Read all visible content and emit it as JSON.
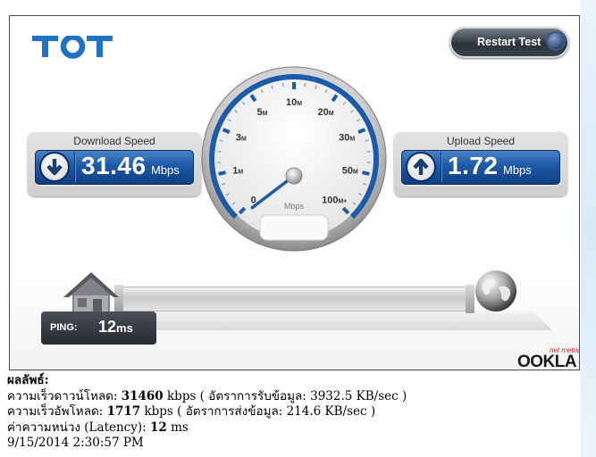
{
  "logo": {
    "text": "TOT"
  },
  "restart_button": {
    "label": "Restart Test"
  },
  "download": {
    "title": "Download Speed",
    "value": "31.46",
    "unit": "Mbps"
  },
  "upload": {
    "title": "Upload Speed",
    "value": "1.72",
    "unit": "Mbps"
  },
  "gauge": {
    "unit": "Mbps",
    "labels": [
      {
        "n": "0",
        "s": ""
      },
      {
        "n": "1",
        "s": "M"
      },
      {
        "n": "3",
        "s": "M"
      },
      {
        "n": "5",
        "s": "M"
      },
      {
        "n": "10",
        "s": "M"
      },
      {
        "n": "20",
        "s": "M"
      },
      {
        "n": "30",
        "s": "M"
      },
      {
        "n": "50",
        "s": "M"
      },
      {
        "n": "100",
        "s": "M+"
      }
    ],
    "arc_fill_fraction": 1.0,
    "needle_fraction": 0.0
  },
  "ping": {
    "label": "PING:",
    "value": "12",
    "unit": "ms"
  },
  "branding": {
    "net_metrics": "net metrics",
    "ookla": "OOKLA"
  },
  "results": {
    "heading": "ผลลัพธ์:",
    "download_line": {
      "prefix": "ความเร็วดาวน์โหลด: ",
      "value": "31460",
      "suffix": " kbps ( อัตราการรับข้อมูล: 3932.5 KB/sec )"
    },
    "upload_line": {
      "prefix": "ความเร็วอัพโหลด: ",
      "value": "1717",
      "suffix": " kbps ( อัตราการส่งข้อมูล: 214.6 KB/sec )"
    },
    "latency_line": {
      "prefix": "ค่าความหน่วง (Latency): ",
      "value": "12",
      "suffix": " ms"
    },
    "timestamp": "9/15/2014 2:30:57 PM"
  },
  "colors": {
    "accent": "#1d5aa7",
    "logo": "#1f72c6"
  }
}
